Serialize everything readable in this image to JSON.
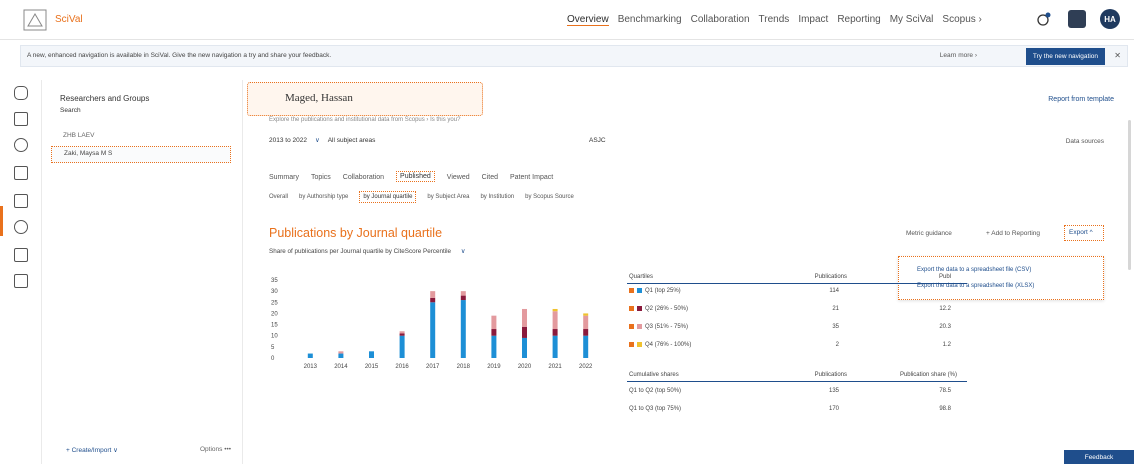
{
  "app": {
    "brand": "SciVal"
  },
  "topnav": [
    {
      "label": "Overview",
      "active": true
    },
    {
      "label": "Benchmarking",
      "active": false
    },
    {
      "label": "Collaboration",
      "active": false
    },
    {
      "label": "Trends",
      "active": false
    },
    {
      "label": "Impact",
      "active": false
    },
    {
      "label": "Reporting",
      "active": false
    },
    {
      "label": "My SciVal",
      "active": false
    },
    {
      "label": "Scopus ›",
      "active": false
    }
  ],
  "user": {
    "initials": "HA"
  },
  "banner": {
    "text": "A new, enhanced navigation is available in SciVal. Give the new navigation a try and share your feedback.",
    "learn_more": "Learn more ›",
    "try_button": "Try the new navigation",
    "close": "✕"
  },
  "sidebar": {
    "title": "Researchers and Groups",
    "search": "Search",
    "items": [
      "ZHB LAEV",
      "Zaki, Maysa M S"
    ],
    "create": "+ Create/Import ∨",
    "options": "Options •••"
  },
  "main": {
    "name": "Maged, Hassan",
    "subline": "Explore the publications and institutional data from Scopus ›   Is this you?",
    "report_template": "Report from template",
    "year_range": "2013 to 2022",
    "subject": "All subject areas",
    "asjc": "ASJC",
    "data_sources": "Data sources",
    "tabs": [
      "Summary",
      "Topics",
      "Collaboration",
      "Published",
      "Viewed",
      "Cited",
      "Patent Impact"
    ],
    "active_tab": "Published",
    "subtabs": [
      "Overall",
      "by Authorship type",
      "by Journal quartile",
      "by Subject Area",
      "by Institution",
      "by Scopus Source"
    ],
    "active_subtab": "by Journal quartile",
    "chart_title": "Publications by Journal quartile",
    "chart_subtitle": "Share of publications per Journal quartile by CiteScore Percentile",
    "metric_guidance": "Metric guidance",
    "add_to_reporting": "+ Add to Reporting",
    "export": "Export ^",
    "export_menu": [
      "Export the data to a spreadsheet file (CSV)",
      "Export the data to a spreadsheet file (XLSX)"
    ],
    "feedback": "Feedback"
  },
  "table": {
    "headers": [
      "Quartiles",
      "Publications",
      "Publ"
    ],
    "rows": [
      {
        "label": "Q1 (top 25%)",
        "publications": "114",
        "share": ""
      },
      {
        "label": "Q2 (26% - 50%)",
        "publications": "21",
        "share": "12.2"
      },
      {
        "label": "Q3 (51% - 75%)",
        "publications": "35",
        "share": "20.3"
      },
      {
        "label": "Q4 (76% - 100%)",
        "publications": "2",
        "share": "1.2"
      }
    ],
    "cumulative_headers": [
      "Cumulative shares",
      "Publications",
      "Publication share (%)"
    ],
    "cumulative_rows": [
      {
        "label": "Q1 to Q2 (top 50%)",
        "publications": "135",
        "share": "78.5"
      },
      {
        "label": "Q1 to Q3 (top 75%)",
        "publications": "170",
        "share": "98.8"
      }
    ]
  },
  "colors": {
    "accent": "#e9711c",
    "q1": "#1d8fd6",
    "q2": "#8a1a3c",
    "q3": "#e39a9e",
    "q4": "#f0c22e",
    "primary": "#1f4e8c"
  },
  "chart_data": {
    "type": "bar",
    "stacked": true,
    "categories": [
      "2013",
      "2014",
      "2015",
      "2016",
      "2017",
      "2018",
      "2019",
      "2020",
      "2021",
      "2022"
    ],
    "series": [
      {
        "name": "Q1 (top 25%)",
        "values": [
          2,
          2,
          3,
          10,
          25,
          26,
          10,
          9,
          10,
          10
        ]
      },
      {
        "name": "Q2 (26% - 50%)",
        "values": [
          0,
          0,
          0,
          1,
          2,
          2,
          3,
          5,
          3,
          3
        ]
      },
      {
        "name": "Q3 (51% - 75%)",
        "values": [
          0,
          1,
          0,
          1,
          3,
          2,
          6,
          8,
          8,
          6
        ]
      },
      {
        "name": "Q4 (76% - 100%)",
        "values": [
          0,
          0,
          0,
          0,
          0,
          0,
          0,
          0,
          1,
          1
        ]
      }
    ],
    "y_ticks": [
      "0",
      "5",
      "10",
      "15",
      "20",
      "25",
      "30",
      "35"
    ],
    "ylim": [
      0,
      35
    ]
  }
}
